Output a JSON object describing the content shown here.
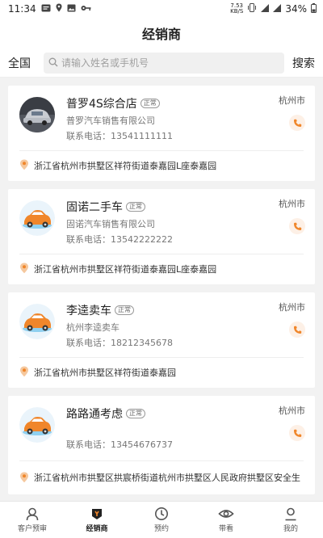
{
  "status": {
    "time": "11:34",
    "speed_value": "7.53",
    "speed_unit": "KB/S",
    "battery": "34%"
  },
  "header": {
    "title": "经销商"
  },
  "search": {
    "scope": "全国",
    "placeholder": "请输入姓名或手机号",
    "button": "搜索"
  },
  "dealers": [
    {
      "name": "普罗4S综合店",
      "tag": "正常",
      "company": "普罗汽车销售有限公司",
      "phone": "联系电话：13541111111",
      "city": "杭州市",
      "address": "浙江省杭州市拱墅区祥符街道泰嘉园L座泰嘉园"
    },
    {
      "name": "固诺二手车",
      "tag": "正常",
      "company": "固诺汽车销售有限公司",
      "phone": "联系电话：13542222222",
      "city": "杭州市",
      "address": "浙江省杭州市拱墅区祥符街道泰嘉园L座泰嘉园"
    },
    {
      "name": "李逵卖车",
      "tag": "正常",
      "company": "杭州李逵卖车",
      "phone": "联系电话：18212345678",
      "city": "杭州市",
      "address": "浙江省杭州市拱墅区祥符街道泰嘉园"
    },
    {
      "name": "路路通考虑",
      "tag": "正常",
      "company": "",
      "phone": "联系电话：13454676737",
      "city": "杭州市",
      "address": "浙江省杭州市拱墅区拱宸桥街道杭州市拱墅区人民政府拱墅区安全生"
    }
  ],
  "tabs": [
    {
      "label": "客户预审",
      "icon": "user-icon"
    },
    {
      "label": "经销商",
      "icon": "dealer-icon"
    },
    {
      "label": "预约",
      "icon": "clock-icon"
    },
    {
      "label": "带看",
      "icon": "eye-icon"
    },
    {
      "label": "我的",
      "icon": "profile-icon"
    }
  ],
  "colors": {
    "accent": "#f0862a",
    "active_tab": "#222222"
  }
}
